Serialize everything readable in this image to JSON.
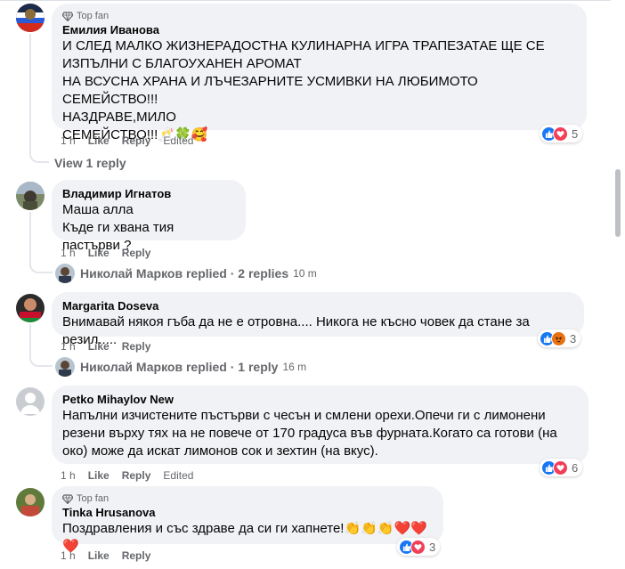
{
  "comments": [
    {
      "badge": "Top fan",
      "author": "Емилия Иванова",
      "text": "И СЛЕД МАЛКО ЖИЗНЕРАДОСТНА КУЛИНАРНА ИГРА ТРАПЕЗАТАЕ ЩЕ СЕ\nИЗПЪЛНИ С БЛАГОУХАНЕН АРОМАТ\nНА ВСУСНА ХРАНА И ЛЪЧЕЗАРНИТЕ УСМИВКИ НА ЛЮБИМОТО СЕМЕЙСТВО!!!\nНАЗДРАВЕ,МИЛО\nСЕМЕЙСТВО!!!🥂🍀🥰",
      "time": "1 h",
      "like": "Like",
      "reply": "Reply",
      "edited": "Edited",
      "reaction_count": "5",
      "reactions": [
        "like",
        "love"
      ]
    },
    {
      "author": "Владимир Игнатов",
      "text": "Маша алла\nКъде ги хвана тия пастърви ?",
      "time": "1 h",
      "like": "Like",
      "reply": "Reply"
    },
    {
      "author": "Margarita Doseva",
      "text": "Внимавай някоя гъба да не е отровна.... Никога не късно човек да стане за резил.....",
      "time": "1 h",
      "like": "Like",
      "reply": "Reply",
      "reaction_count": "3",
      "reactions": [
        "like",
        "angry"
      ]
    },
    {
      "author": "Petko Mihaylov New",
      "text": "Напълни изчистените пъстърви с чесън и смлени орехи.Опечи ги с лимонени\nрезени върху тях на не повече от 170 градуса във фурната.Когато са готови (на\nоко) може да искат лимонов сок и зехтин (на вкус).",
      "time": "1 h",
      "like": "Like",
      "reply": "Reply",
      "edited": "Edited",
      "reaction_count": "6",
      "reactions": [
        "like",
        "love"
      ]
    },
    {
      "badge": "Top fan",
      "author": "Tinka Hrusanova",
      "text": "Поздравления и със здраве да си ги хапнете!👏👏👏❤️❤️❤️",
      "time": "1 h",
      "like": "Like",
      "reply": "Reply",
      "reaction_count": "3",
      "reactions": [
        "like",
        "love"
      ]
    }
  ],
  "threads": {
    "view_replies": "View 1 reply",
    "vladimir_replies": {
      "text": "Николай Марков replied · 2 replies",
      "time": "10 m"
    },
    "margarita_replies": {
      "text": "Николай Марков replied · 1 reply",
      "time": "16 m"
    }
  },
  "colors": {
    "bubble": "#f0f2f5",
    "like_blue": "#1877f2",
    "love_red": "#f33e58",
    "angry_orange": "#e9710f",
    "muted": "#65676b"
  }
}
